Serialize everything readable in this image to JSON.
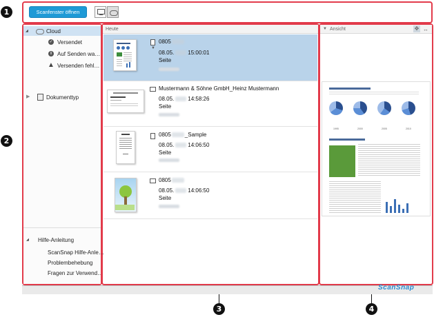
{
  "toolbar": {
    "open_scan_window_label": "Scanfenster öffnen"
  },
  "sidebar": {
    "cloud_label": "Cloud",
    "cloud_items": [
      {
        "label": "Versendet",
        "icon": "check-circle-icon"
      },
      {
        "label": "Auf Senden wa…",
        "icon": "pause-circle-icon"
      },
      {
        "label": "Versenden fehl…",
        "icon": "warning-icon"
      }
    ],
    "doctype_label": "Dokumenttyp",
    "help_label": "Hilfe-Anleitung",
    "help_items": [
      {
        "label": "ScanSnap Hilfe-Anle…"
      },
      {
        "label": "Problembehebung"
      },
      {
        "label": "Fragen zur Verwend…"
      }
    ]
  },
  "list": {
    "header": "Heute",
    "rows": [
      {
        "title": "0805",
        "date": "08.05.",
        "time": "15:00:01",
        "pages": "Seite",
        "selected": true
      },
      {
        "title": "Mustermann & Söhne GmbH_Heinz Mustermann",
        "date": "08.05.",
        "time": "14:58:26",
        "pages": "Seite",
        "selected": false
      },
      {
        "title": "0805",
        "title_suffix": "_Sample",
        "date": "08.05.",
        "time": "14:06:50",
        "pages": "Seite",
        "selected": false
      },
      {
        "title": "0805",
        "date": "08.05.",
        "time": "14:06:50",
        "pages": "Seite",
        "selected": false
      }
    ]
  },
  "preview": {
    "header": "Ansicht",
    "pie_years": [
      "1995",
      "2000",
      "2005",
      "2010"
    ]
  },
  "footer": {
    "brand": "ScanSnap"
  },
  "callouts": [
    "1",
    "2",
    "3",
    "4"
  ],
  "colors": {
    "accent_button": "#1e9ad6",
    "selection": "#b9d3ea",
    "callout_border": "#e23a4a",
    "sidebar_selection": "#cfe2f3"
  }
}
